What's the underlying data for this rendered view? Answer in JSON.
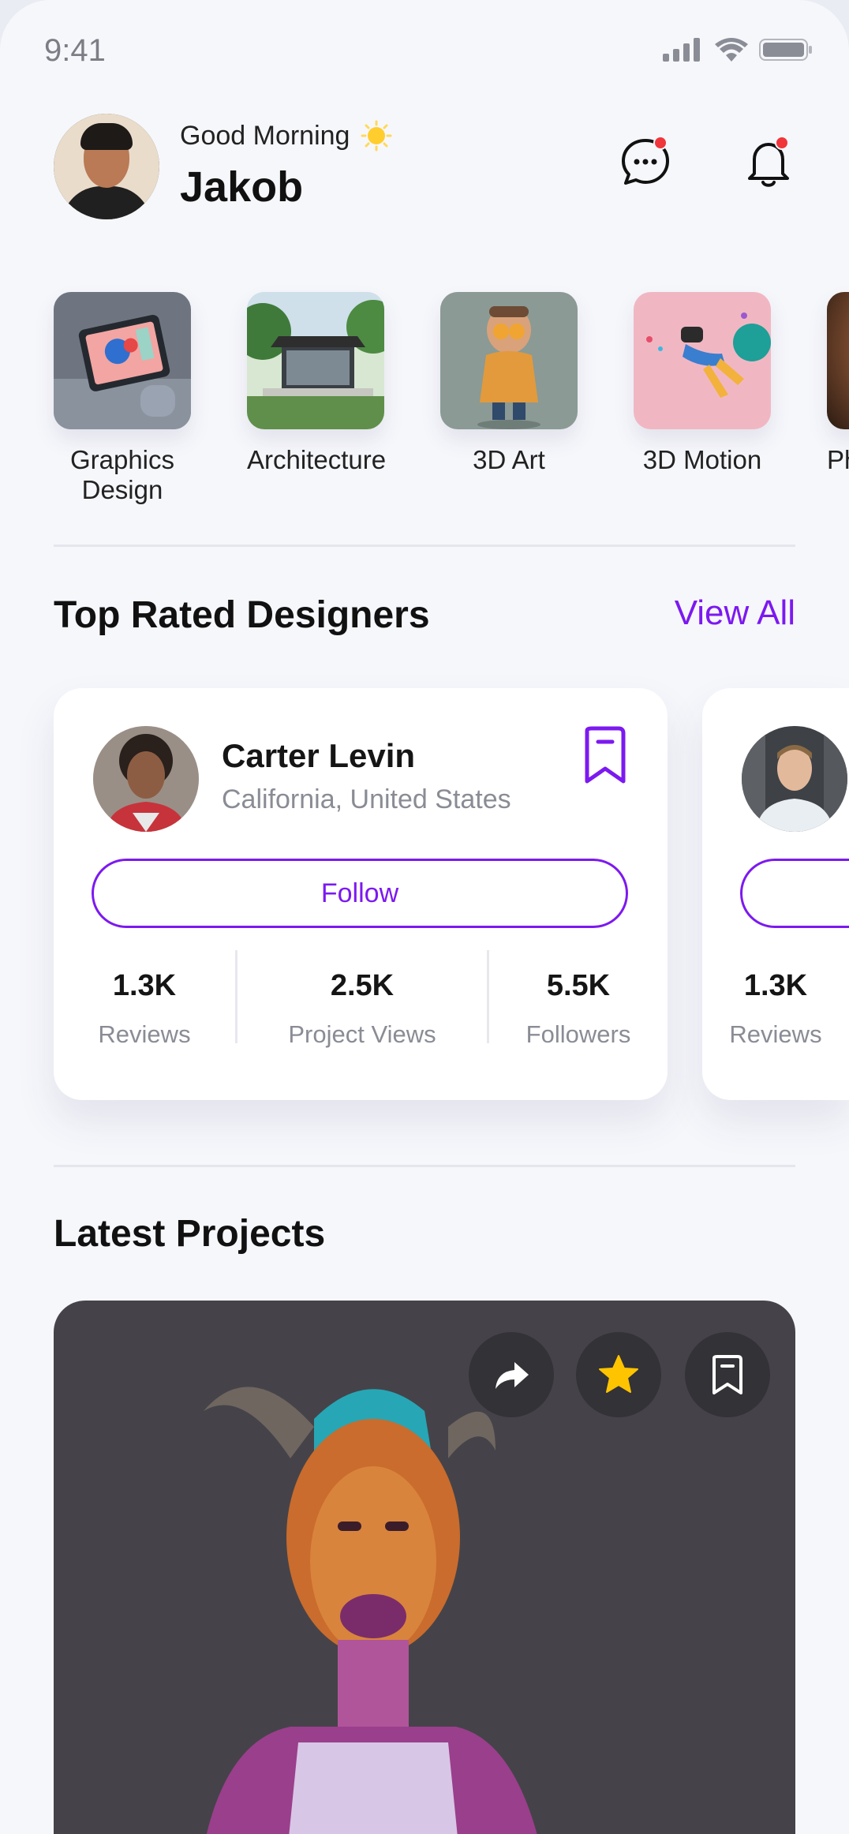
{
  "status_bar": {
    "time": "9:41"
  },
  "header": {
    "greeting": "Good Morning",
    "greeting_emoji": "☀️",
    "username": "Jakob"
  },
  "categories": [
    {
      "label": "Graphics Design"
    },
    {
      "label": "Architecture"
    },
    {
      "label": "3D Art"
    },
    {
      "label": "3D Motion"
    },
    {
      "label": "Pho"
    }
  ],
  "top_designers": {
    "title": "Top Rated Designers",
    "view_all": "View All",
    "cards": [
      {
        "name": "Carter Levin",
        "location": "California, United States",
        "follow_label": "Follow",
        "stats": [
          {
            "value": "1.3K",
            "label": "Reviews"
          },
          {
            "value": "2.5K",
            "label": "Project Views"
          },
          {
            "value": "5.5K",
            "label": "Followers"
          }
        ]
      },
      {
        "stats": [
          {
            "value": "1.3K",
            "label": "Reviews"
          }
        ]
      }
    ]
  },
  "latest_projects": {
    "title": "Latest Projects"
  },
  "colors": {
    "accent": "#7c19f0",
    "notification_dot": "#f0353b",
    "star": "#ffc400"
  }
}
